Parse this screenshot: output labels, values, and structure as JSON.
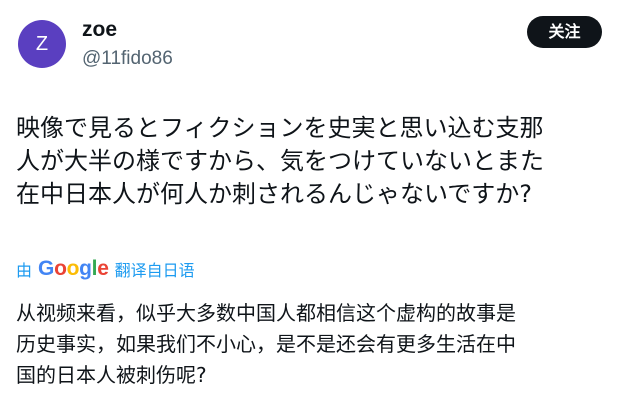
{
  "user": {
    "avatar_letter": "Z",
    "display_name": "zoe",
    "handle": "@11fido86",
    "avatar_color": "#5a3fc0"
  },
  "follow_button": {
    "label": "关注"
  },
  "post": {
    "lines": [
      "映像で見るとフィクションを史実と思い込む支那",
      "人が大半の様ですから、気をつけていないとまた",
      "在中日本人が何人か刺されるんじゃないですか?"
    ]
  },
  "translation": {
    "by_label": "由",
    "google_logo": "Google",
    "link_label": "翻译自日语",
    "link_color": "#1d9bf0",
    "lines": [
      "从视频来看，似乎大多数中国人都相信这个虚构的故事是",
      "历史事实，如果我们不小心，是不是还会有更多生活在中",
      "国的日本人被刺伤呢?"
    ]
  }
}
